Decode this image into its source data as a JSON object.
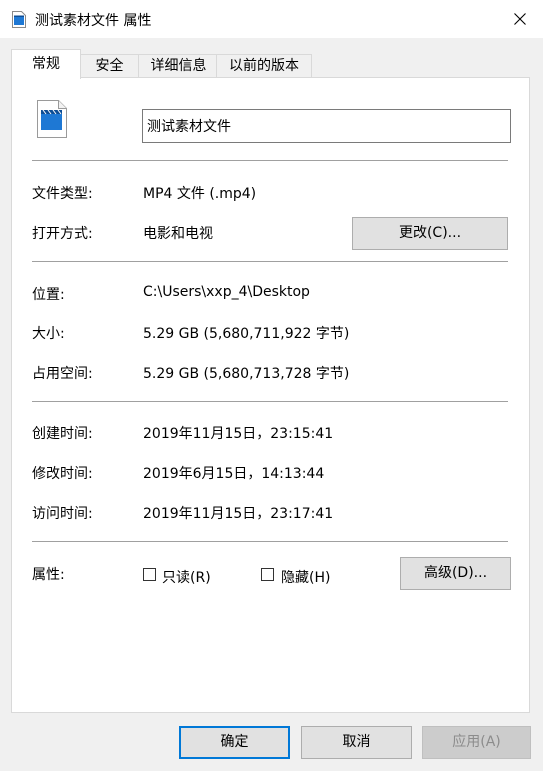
{
  "window": {
    "title": "测试素材文件 属性"
  },
  "icons": {
    "title_icon": "video-file-icon",
    "close": "close-icon",
    "file": "video-file-icon"
  },
  "tabs": [
    {
      "label": "常规",
      "active": true
    },
    {
      "label": "安全",
      "active": false
    },
    {
      "label": "详细信息",
      "active": false
    },
    {
      "label": "以前的版本",
      "active": false
    }
  ],
  "general": {
    "file_name": "测试素材文件",
    "file_type_label": "文件类型:",
    "file_type_value": "MP4 文件 (.mp4)",
    "open_with_label": "打开方式:",
    "open_with_value": "电影和电视",
    "change_button": "更改(C)...",
    "location_label": "位置:",
    "location_value": "C:\\Users\\xxp_4\\Desktop",
    "size_label": "大小:",
    "size_value": "5.29 GB (5,680,711,922 字节)",
    "size_on_disk_label": "占用空间:",
    "size_on_disk_value": "5.29 GB (5,680,713,728 字节)",
    "created_label": "创建时间:",
    "created_value": "2019年11月15日，23:15:41",
    "modified_label": "修改时间:",
    "modified_value": "2019年6月15日，14:13:44",
    "accessed_label": "访问时间:",
    "accessed_value": "2019年11月15日，23:17:41",
    "attributes_label": "属性:",
    "readonly_label": "只读(R)",
    "readonly_checked": false,
    "hidden_label": "隐藏(H)",
    "hidden_checked": false,
    "advanced_button": "高级(D)..."
  },
  "footer": {
    "ok": "确定",
    "cancel": "取消",
    "apply": "应用(A)"
  },
  "colors": {
    "accent": "#0078d7",
    "panel": "#ffffff",
    "dialog": "#f0f0f0"
  }
}
